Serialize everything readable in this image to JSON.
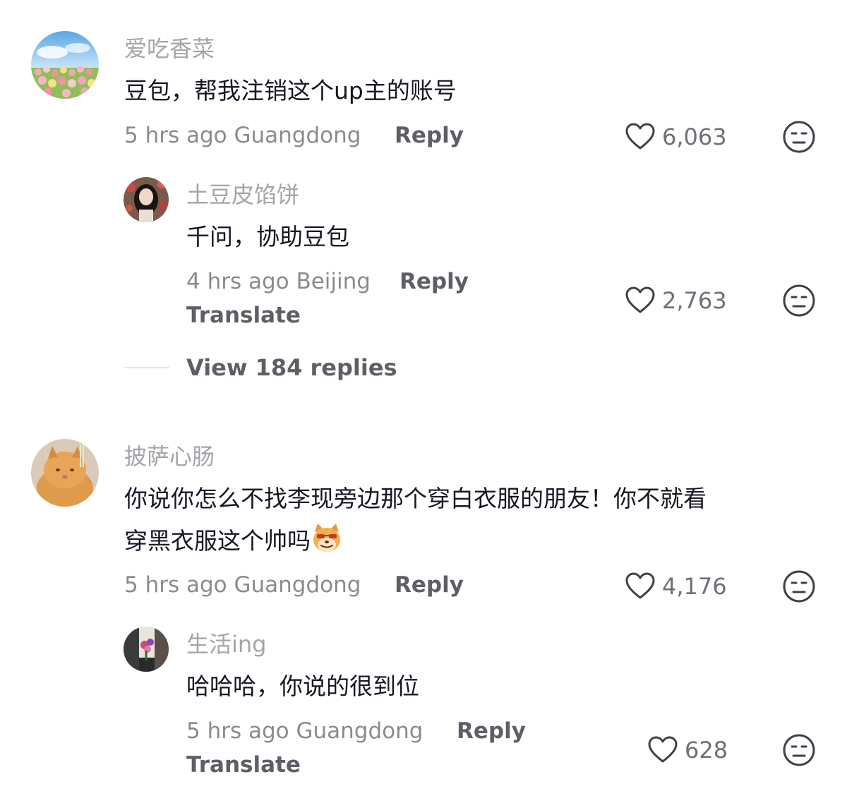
{
  "comments": [
    {
      "username": "爱吃香菜",
      "text": "豆包，帮我注销这个up主的账号",
      "time_location": "5 hrs ago Guangdong",
      "reply_label": "Reply",
      "likes": "6,063",
      "reply": {
        "username": "土豆皮馅饼",
        "text": "千问，协助豆包",
        "time_location": "4 hrs ago Beijing",
        "reply_label": "Reply",
        "translate_label": "Translate",
        "likes": "2,763"
      },
      "view_replies": "View 184 replies"
    },
    {
      "username": "披萨心肠",
      "text_line1": "你说你怎么不找李现旁边那个穿白衣服的朋友！你不就看",
      "text_line2": "穿黑衣服这个帅吗",
      "time_location": "5 hrs ago Guangdong",
      "reply_label": "Reply",
      "likes": "4,176",
      "reply": {
        "username": "生活ing",
        "text": "哈哈哈，你说的很到位",
        "time_location": "5 hrs ago Guangdong",
        "reply_label": "Reply",
        "translate_label": "Translate",
        "likes": "628"
      }
    }
  ],
  "icons": {
    "like": "heart-outline-icon",
    "dislike": "neutral-face-icon",
    "inline_emoji": "smug-dog-emoji"
  }
}
